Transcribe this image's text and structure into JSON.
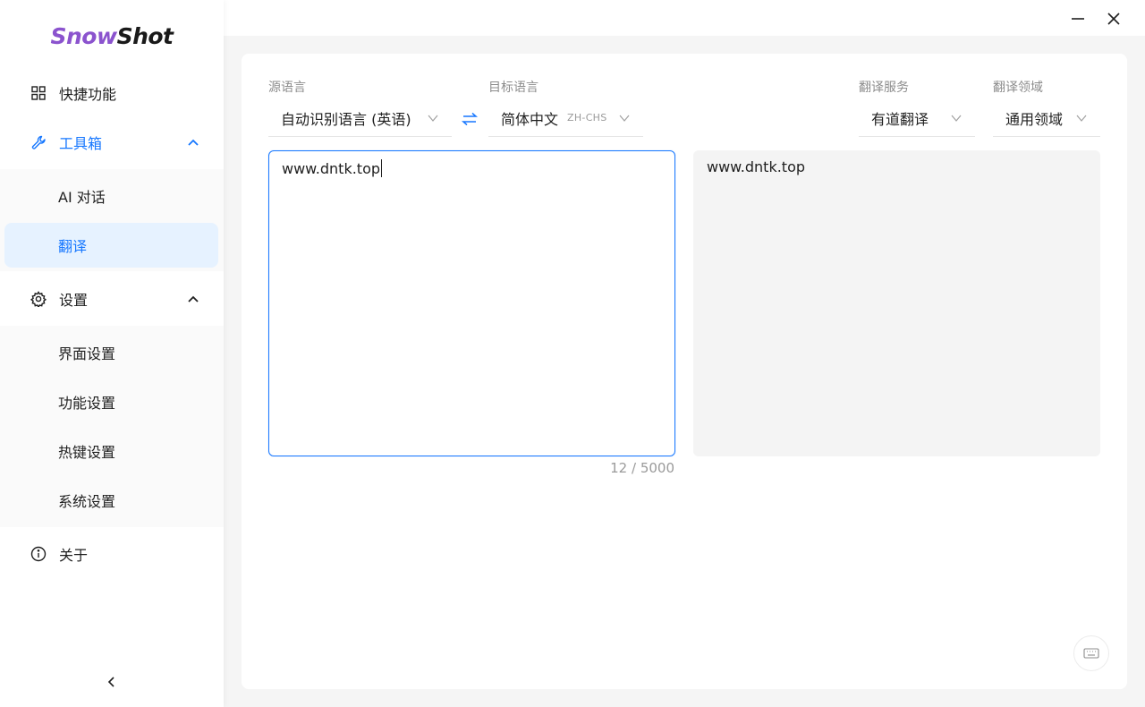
{
  "app": {
    "logo_part1": "Snow",
    "logo_part2": "Shot"
  },
  "sidebar": {
    "items": [
      {
        "label": "快捷功能",
        "icon": "grid-icon"
      },
      {
        "label": "工具箱",
        "icon": "wrench-icon",
        "expanded": true
      },
      {
        "label": "AI 对话"
      },
      {
        "label": "翻译",
        "selected": true
      },
      {
        "label": "设置",
        "icon": "gear-icon",
        "expanded": true
      },
      {
        "label": "界面设置"
      },
      {
        "label": "功能设置"
      },
      {
        "label": "热键设置"
      },
      {
        "label": "系统设置"
      },
      {
        "label": "关于",
        "icon": "info-icon"
      }
    ]
  },
  "translate": {
    "source_label": "源语言",
    "source_value": "自动识别语言 (英语)",
    "target_label": "目标语言",
    "target_value": "简体中文",
    "target_code": "ZH-CHS",
    "service_label": "翻译服务",
    "service_value": "有道翻译",
    "domain_label": "翻译领域",
    "domain_value": "通用领域",
    "input_text": "www.dntk.top",
    "output_text": "www.dntk.top",
    "counter": "12 / 5000"
  },
  "colors": {
    "accent": "#1677ff",
    "logo_purple": "#8b53ce",
    "submenu_bg": "#fafafa",
    "selected_bg": "#e6f2ff"
  }
}
